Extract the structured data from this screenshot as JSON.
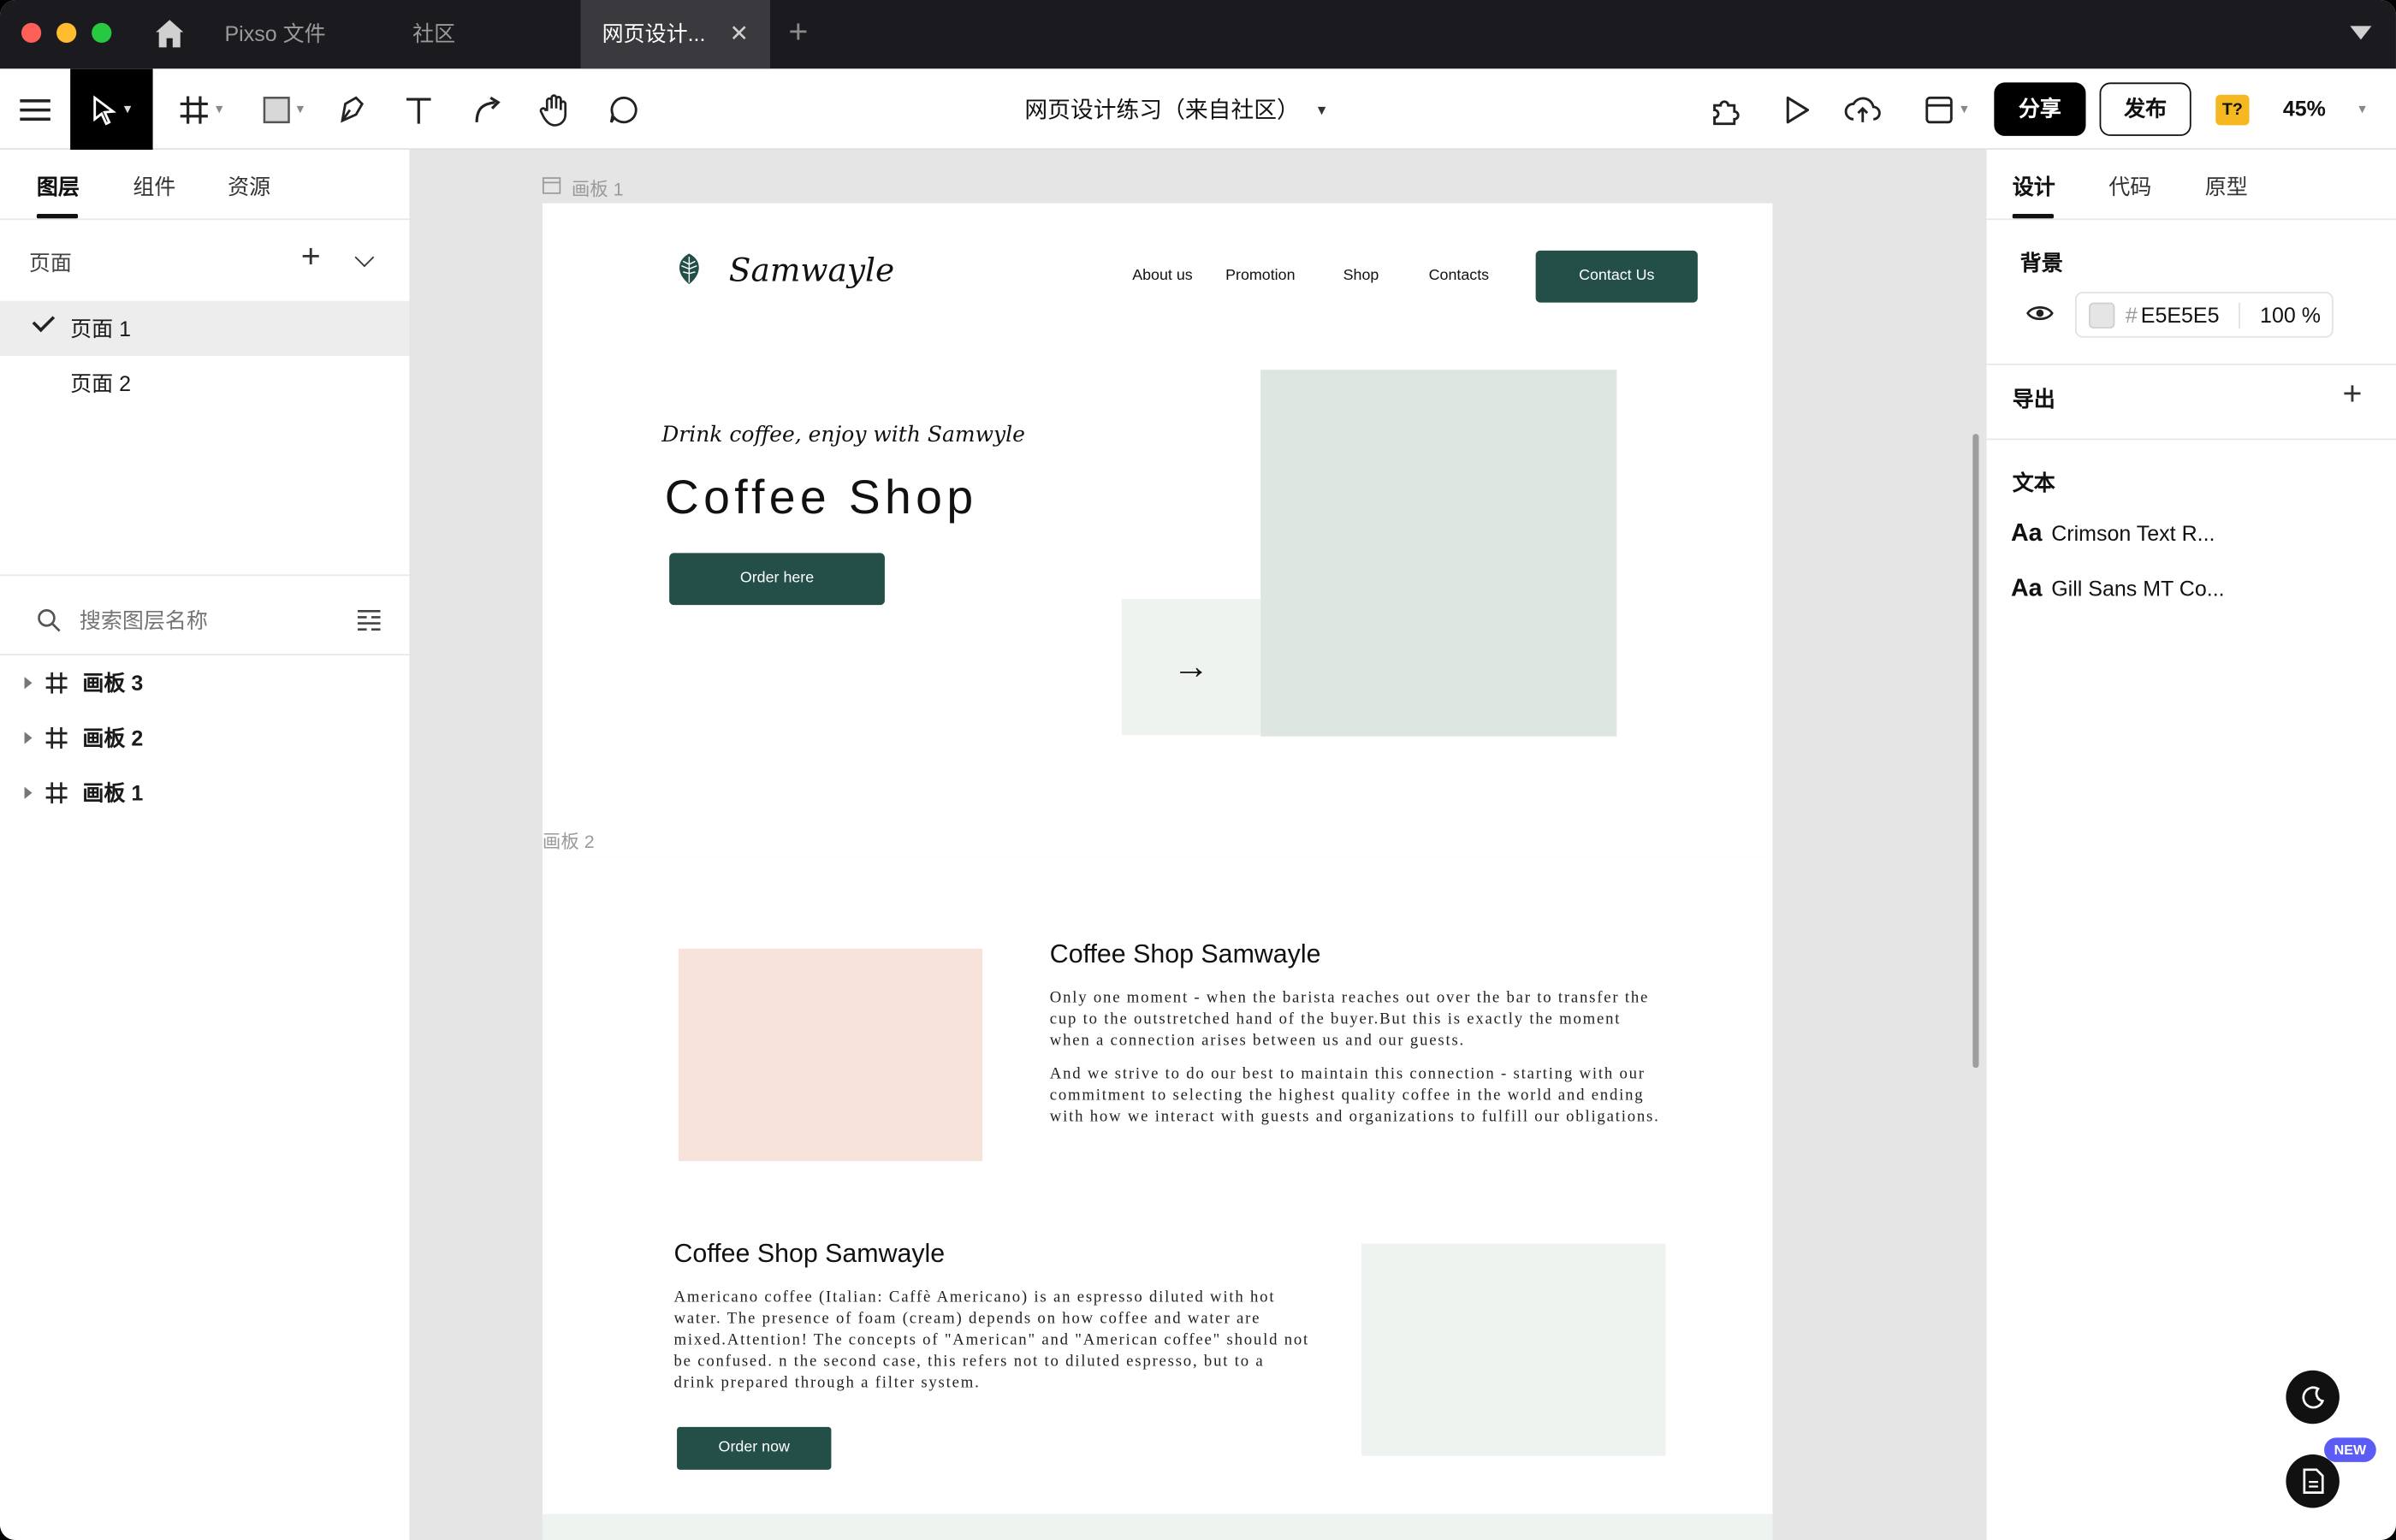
{
  "titlebar": {
    "tabs": [
      {
        "label": "Pixso 文件"
      },
      {
        "label": "社区"
      },
      {
        "label": "网页设计..."
      }
    ]
  },
  "toolbar": {
    "file_title": "网页设计练习（来自社区）",
    "share_label": "分享",
    "publish_label": "发布",
    "text_badge": "T?",
    "zoom": "45%"
  },
  "left_panel": {
    "tabs": [
      "图层",
      "组件",
      "资源"
    ],
    "pages_label": "页面",
    "pages": [
      "页面 1",
      "页面 2"
    ],
    "search_placeholder": "搜索图层名称",
    "layers": [
      "画板 3",
      "画板 2",
      "画板 1"
    ]
  },
  "canvas": {
    "board1_label": "画板 1",
    "board2_label": "画板 2",
    "site": {
      "logo": "Samwayle",
      "nav": [
        "About us",
        "Promotion",
        "Shop",
        "Contacts"
      ],
      "contact_button": "Contact Us",
      "tagline": "Drink coffee, enjoy with Samwyle",
      "hero_title": "Coffee Shop",
      "order_here": "Order here",
      "arrow": "→",
      "section1_title": "Coffee Shop Samwayle",
      "section1_p1": "Only one moment - when the barista reaches out over the bar to transfer the cup to the outstretched hand of the buyer.But this is exactly the moment when a connection arises between us and our guests.",
      "section1_p2": "And we strive to do our best to maintain this connection - starting with our commitment to selecting the highest quality coffee in the world and ending with how we interact with guests and organizations to fulfill our obligations.",
      "section2_title": "Coffee Shop Samwayle",
      "section2_p": "Americano coffee (Italian: Caffè Americano) is an espresso diluted with hot water. The presence of foam (cream) depends on how coffee and water are mixed.Attention! The concepts of \"American\" and \"American coffee\" should not be confused. n the second case, this refers not to diluted espresso, but to a drink prepared through a filter system.",
      "order_now": "Order now"
    }
  },
  "right_panel": {
    "tabs": [
      "设计",
      "代码",
      "原型"
    ],
    "background_label": "背景",
    "hex_prefix": "#",
    "bg_hex": "E5E5E5",
    "bg_opacity": "100 %",
    "export_label": "导出",
    "text_label": "文本",
    "fonts": [
      {
        "prefix": "Aa",
        "name": "Crimson Text R..."
      },
      {
        "prefix": "Aa",
        "name": "Gill Sans MT Co..."
      }
    ],
    "new_badge": "NEW"
  },
  "colors": {
    "brand_green": "#234f48",
    "peach": "#f7e3da",
    "sage": "#dde6e1",
    "sage_light": "#eef3f0",
    "badge_yellow": "#f5b820",
    "new_badge": "#5b5bf6"
  }
}
